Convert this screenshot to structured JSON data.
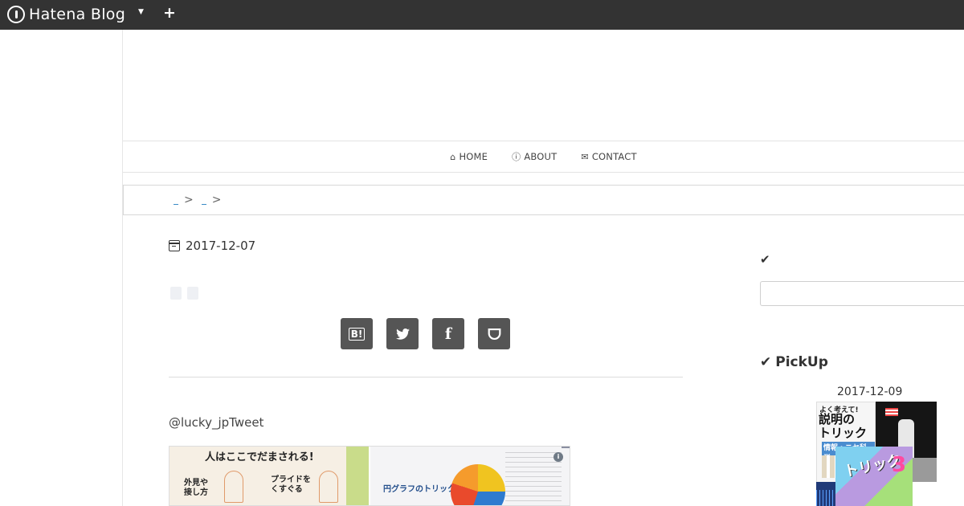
{
  "topbar": {
    "brand": "Hatena Blog",
    "dropdown_icon": "caret-down-icon",
    "add_icon": "plus-icon",
    "background": "#333333"
  },
  "nav": {
    "items": [
      {
        "icon": "home-icon",
        "label": "HOME"
      },
      {
        "icon": "info-circle-icon",
        "label": "ABOUT"
      },
      {
        "icon": "envelope-icon",
        "label": "CONTACT"
      }
    ]
  },
  "breadcrumb": {
    "separators": [
      ">",
      ">"
    ]
  },
  "article": {
    "date": "2017-12-07",
    "share_buttons": [
      {
        "icon": "hatena-bookmark-icon",
        "label": "B!"
      },
      {
        "icon": "twitter-icon",
        "label": "🐦"
      },
      {
        "icon": "facebook-icon",
        "label": "f"
      },
      {
        "icon": "pocket-icon",
        "label": "⌵"
      }
    ],
    "tweet_user": "@lucky_jpTweet",
    "embed": {
      "left_title": "人はここでだまされる!",
      "left_caption_1": "外見や\n接し方",
      "left_caption_2": "プライドを\nくすぐる",
      "right_title": "円グラフのトリック"
    }
  },
  "sidebar": {
    "check_icon": "check-icon",
    "pickup_label": "PickUp",
    "pickup_date": "2017-12-09",
    "book1": {
      "top": "よく考えて!",
      "big": "説明の\nトリック",
      "sub": "情報・ニセ科学"
    },
    "book3": {
      "title": "トリック",
      "num": "3"
    }
  }
}
